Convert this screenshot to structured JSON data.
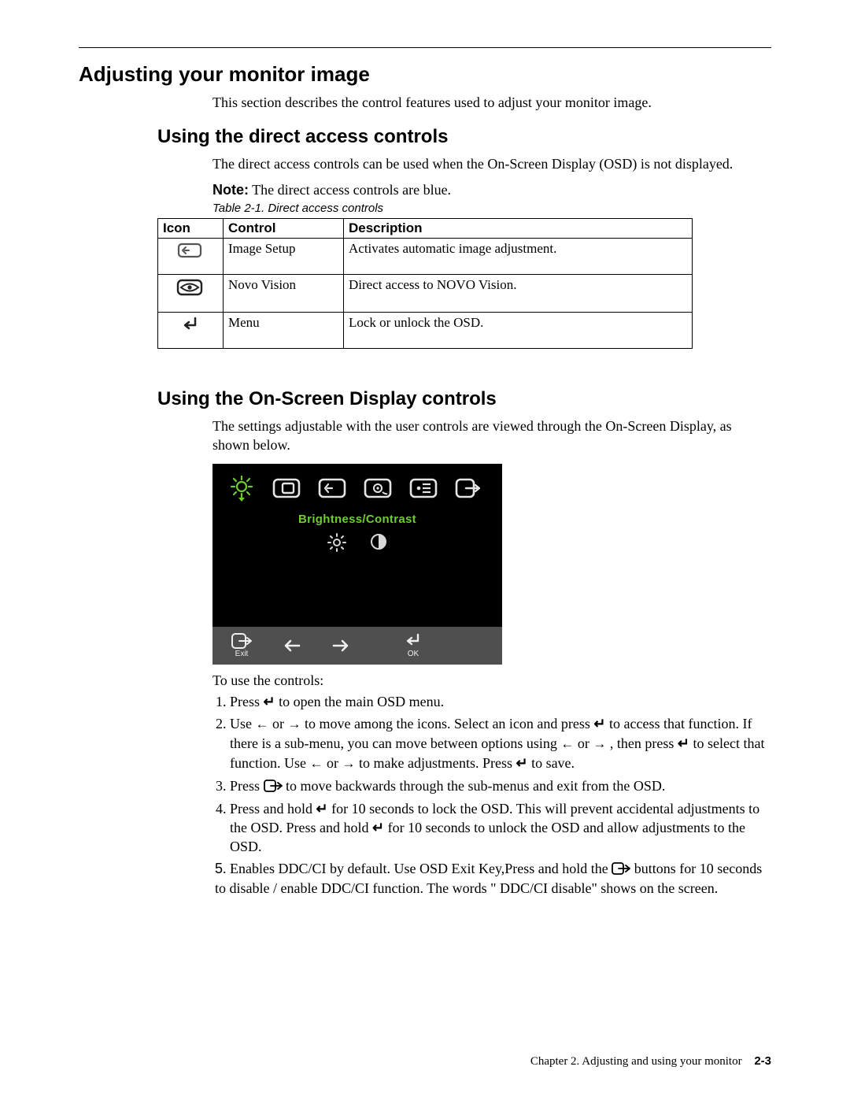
{
  "headings": {
    "main": "Adjusting your monitor image",
    "sub1": "Using the direct access controls",
    "sub2": "Using the On-Screen Display controls"
  },
  "intro": "This section describes the control features used to adjust your monitor image.",
  "direct_access_intro": "The direct access controls can be used when the On-Screen Display (OSD) is not displayed.",
  "note_label": "Note:",
  "note_text": " The direct access controls are blue.",
  "table_caption": "Table 2-1. Direct access controls",
  "table": {
    "headers": {
      "icon": "Icon",
      "control": "Control",
      "description": "Description"
    },
    "rows": [
      {
        "icon": "image-setup-icon",
        "control": "Image Setup",
        "description": "Activates automatic image adjustment."
      },
      {
        "icon": "novo-vision-icon",
        "control": "Novo Vision",
        "description": "Direct access to NOVO Vision."
      },
      {
        "icon": "menu-enter-icon",
        "control": "Menu",
        "description": "Lock or unlock the OSD."
      }
    ]
  },
  "osd_intro": "The settings adjustable with the user controls are viewed through the On-Screen Display,  as shown below.",
  "osd": {
    "title": "Brightness/Contrast",
    "exit_label": "Exit",
    "ok_label": "OK"
  },
  "to_use": "To use the controls:",
  "steps": {
    "s1a": "Press ",
    "s1b": " to open the main OSD menu.",
    "s2a": "Use ",
    "s2b": " or ",
    "s2c": " to move among the icons. Select an icon and press ",
    "s2d": " to access that function. If there is a sub-menu, you can move between options using ",
    "s2e": " or ",
    "s2f": " , then press ",
    "s2g": " to select that function. Use ",
    "s2h": " or ",
    "s2i": " to make adjustments. Press ",
    "s2j": " to save.",
    "s3a": "Press ",
    "s3b": " to move backwards through the sub-menus and exit from the OSD.",
    "s4a": "Press and hold ",
    "s4b": " for 10 seconds to lock the OSD. This will prevent accidental adjustments to the OSD. Press and hold ",
    "s4c": " for 10 seconds to unlock the OSD and allow adjustments to the OSD.",
    "s5num": "5",
    "s5a": ". Enables DDC/CI by default. Use OSD Exit Key,Press and hold the ",
    "s5b": " buttons  for 10 seconds to disable / enable DDC/CI function. The words \" DDC/CI disable\" shows on the screen."
  },
  "footer": {
    "chapter": "Chapter 2. Adjusting and using your monitor",
    "page": "2-3"
  }
}
